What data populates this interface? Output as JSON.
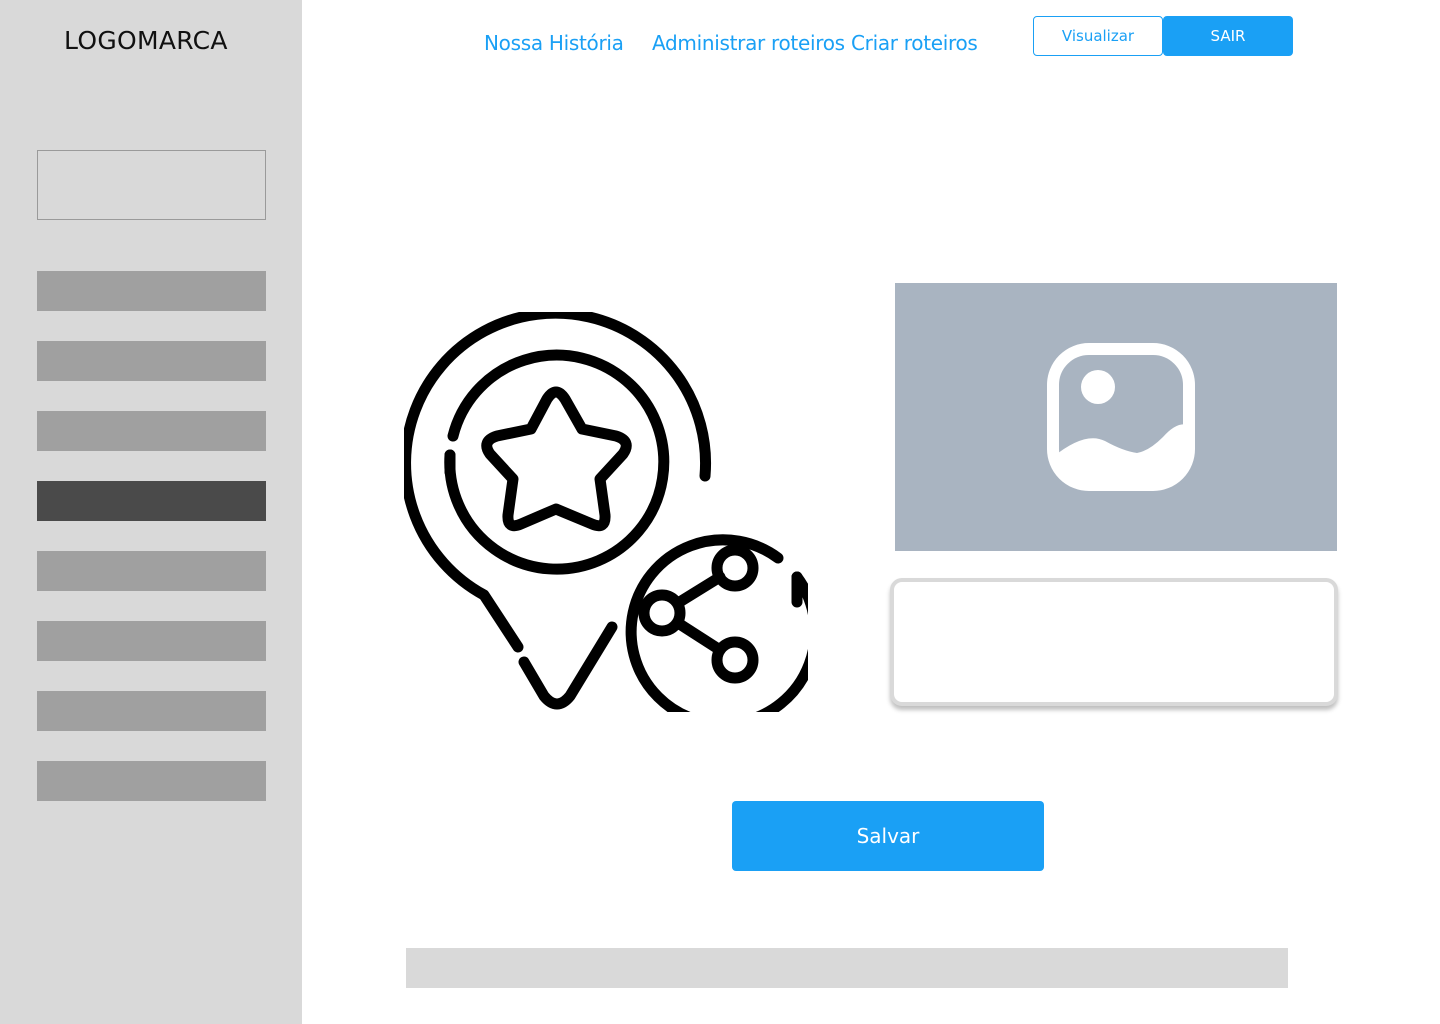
{
  "sidebar": {
    "logo": "LOGOMARCA",
    "search_box": "",
    "items": [
      {
        "state": "normal"
      },
      {
        "state": "normal"
      },
      {
        "state": "normal"
      },
      {
        "state": "active"
      },
      {
        "state": "normal"
      },
      {
        "state": "normal"
      },
      {
        "state": "normal"
      },
      {
        "state": "normal"
      }
    ]
  },
  "header": {
    "nav": [
      "Nossa História",
      "Administrar roteiros",
      "Criar roteiros"
    ],
    "visualizar_label": "Visualizar",
    "sair_label": "SAIR"
  },
  "main": {
    "hero_icon": "map-pin-star-share-icon",
    "image_icon": "image-icon",
    "text_box_value": "",
    "save_label": "Salvar"
  },
  "colors": {
    "accent": "#1aa0f5",
    "sidebar_bg": "#d9d9d9",
    "sidebar_item": "#a0a0a0",
    "sidebar_item_active": "#4a4a4a",
    "image_placeholder": "#a9b4c1"
  }
}
